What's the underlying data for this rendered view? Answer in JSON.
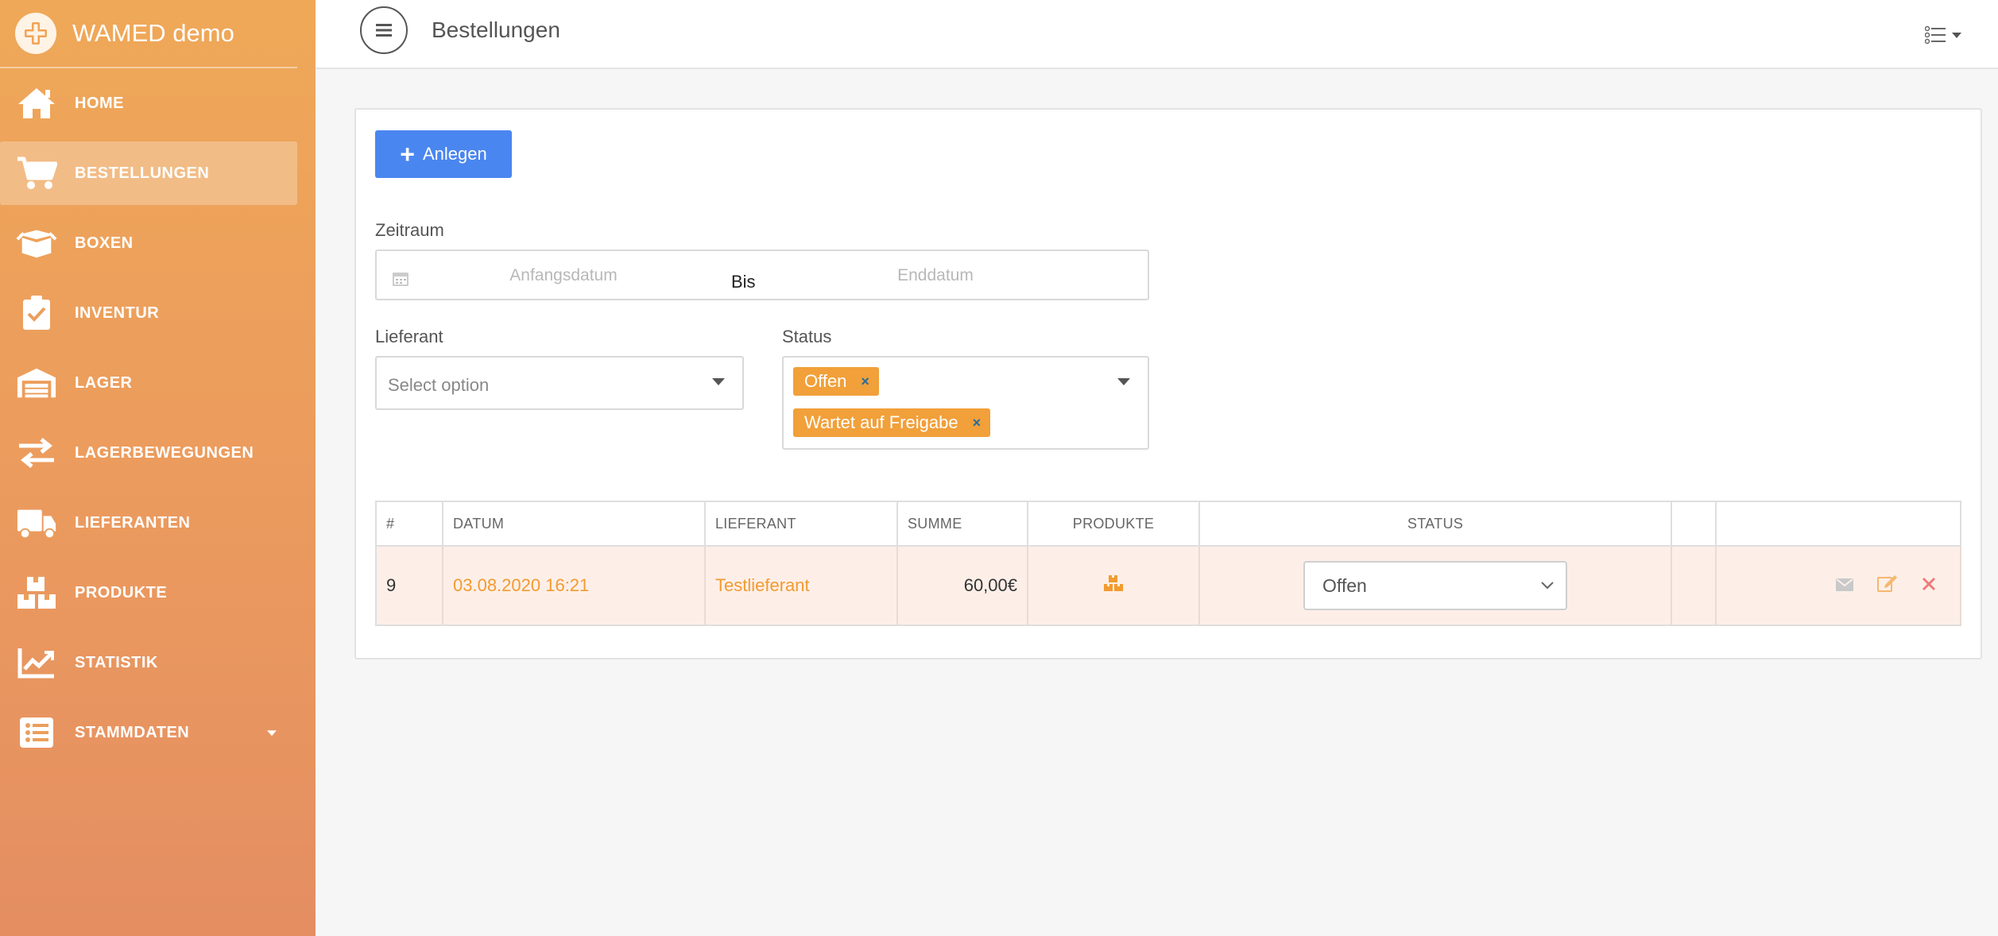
{
  "brand": {
    "title": "WAMED demo"
  },
  "sidebar": {
    "items": [
      {
        "label": "HOME",
        "icon": "home-icon"
      },
      {
        "label": "BESTELLUNGEN",
        "icon": "cart-icon",
        "active": true
      },
      {
        "label": "BOXEN",
        "icon": "box-icon"
      },
      {
        "label": "INVENTUR",
        "icon": "clipboard-check-icon"
      },
      {
        "label": "LAGER",
        "icon": "warehouse-icon"
      },
      {
        "label": "LAGERBEWEGUNGEN",
        "icon": "exchange-icon"
      },
      {
        "label": "LIEFERANTEN",
        "icon": "truck-icon"
      },
      {
        "label": "PRODUKTE",
        "icon": "boxes-icon"
      },
      {
        "label": "STATISTIK",
        "icon": "chart-icon"
      },
      {
        "label": "STAMMDATEN",
        "icon": "list-icon",
        "has_submenu": true
      }
    ]
  },
  "header": {
    "title": "Bestellungen"
  },
  "toolbar": {
    "create_label": "Anlegen"
  },
  "filters": {
    "period_label": "Zeitraum",
    "start_placeholder": "Anfangsdatum",
    "separator": "Bis",
    "end_placeholder": "Enddatum",
    "supplier_label": "Lieferant",
    "supplier_placeholder": "Select option",
    "status_label": "Status",
    "status_tags": [
      "Offen",
      "Wartet auf Freigabe"
    ],
    "tag_remove": "×"
  },
  "table": {
    "headers": [
      "#",
      "DATUM",
      "LIEFERANT",
      "SUMME",
      "PRODUKTE",
      "STATUS",
      "",
      ""
    ],
    "rows": [
      {
        "id": "9",
        "date": "03.08.2020 16:21",
        "supplier": "Testlieferant",
        "sum": "60,00€",
        "status": "Offen"
      }
    ]
  },
  "colors": {
    "accent": "#f29b2f",
    "primary_button": "#4a86f0",
    "row_highlight": "#fdefe8",
    "delete": "#f07a7a",
    "edit": "#f5b870"
  }
}
